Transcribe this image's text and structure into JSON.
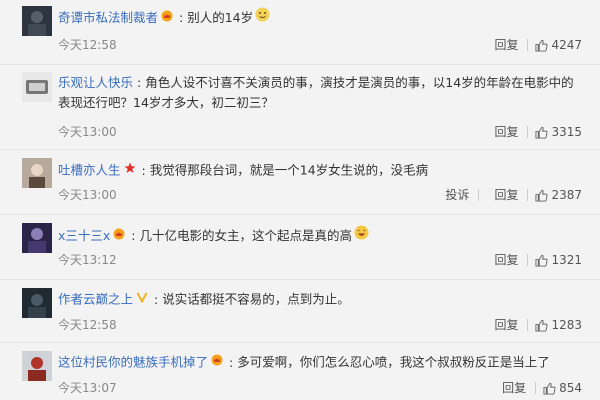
{
  "comments": [
    {
      "user": "奇谭市私法制裁者",
      "badge": "vip-crown-icon",
      "content": "别人的14岁",
      "emoji": "doge-emoji-icon",
      "time": "今天12:58",
      "reply_label": "回复",
      "likes": "4247"
    },
    {
      "user": "乐观让人快乐",
      "badge": "",
      "content": "角色人设不讨喜不关演员的事，演技才是演员的事，以14岁的年龄在电影中的表现还行吧？14岁才多大，初二初三？",
      "time": "今天13:00",
      "reply_label": "回复",
      "likes": "3315"
    },
    {
      "user": "吐槽亦人生",
      "badge": "red-star-icon",
      "content": "我觉得那段台词，就是一个14岁女生说的，没毛病",
      "time": "今天13:00",
      "report_label": "投诉",
      "reply_label": "回复",
      "likes": "2387"
    },
    {
      "user": "x三十三x",
      "badge": "vip-crown-icon",
      "content": "几十亿电影的女主，这个起点是真的高",
      "emoji": "laughing-emoji-icon",
      "time": "今天13:12",
      "reply_label": "回复",
      "likes": "1321"
    },
    {
      "user": "作者云巅之上",
      "badge": "v-verified-icon",
      "content": "说实话都挺不容易的，点到为止。",
      "time": "今天12:58",
      "reply_label": "回复",
      "likes": "1283"
    },
    {
      "user": "这位村民你的魅族手机掉了",
      "badge": "vip-crown-icon",
      "content": "多可爱啊，你们怎么忍心喷，我这个叔叔粉反正是当上了",
      "time": "今天13:07",
      "reply_label": "回复",
      "likes": "854"
    }
  ],
  "colors": {
    "username": "#3b6dbe",
    "background": "#f3f3f3",
    "time": "#888888"
  },
  "icons": {
    "like": "thumbs-up-icon"
  }
}
